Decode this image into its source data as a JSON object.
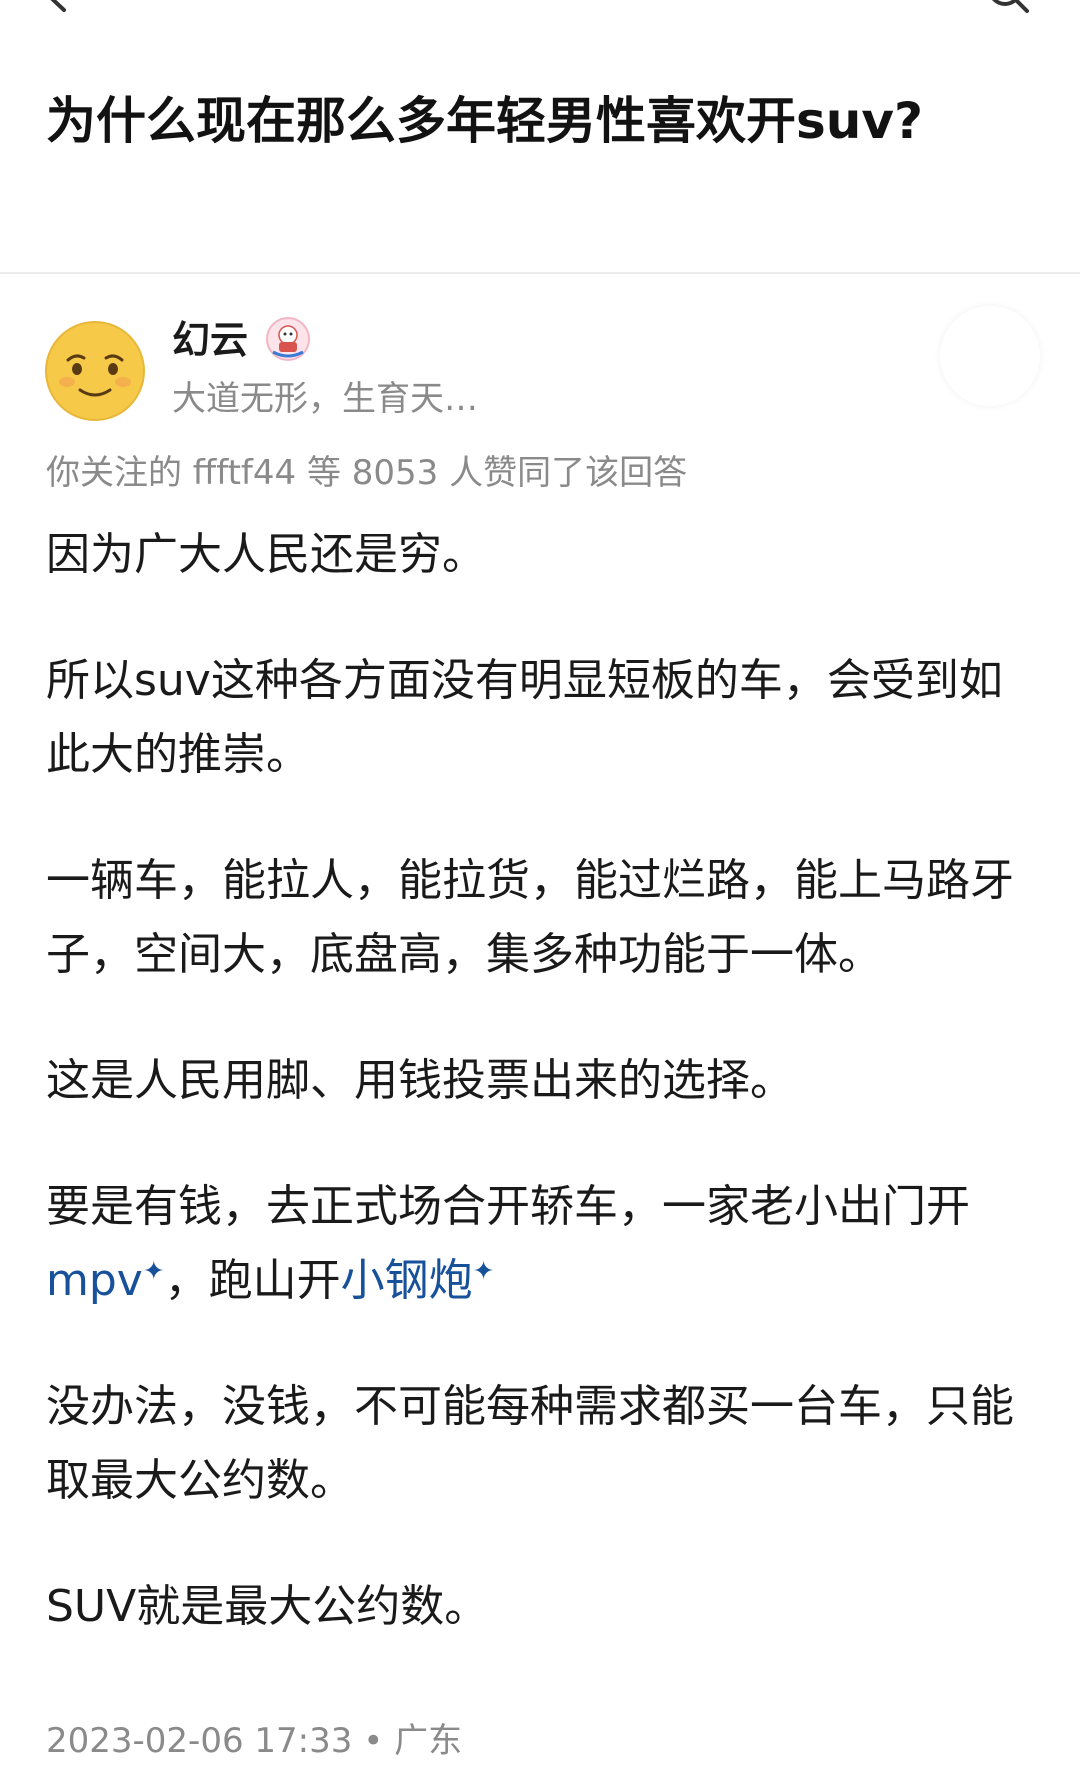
{
  "question": {
    "title": "为什么现在那么多年轻男性喜欢开suv?"
  },
  "author": {
    "name": "幻云",
    "bio": "大道无形，生育天…"
  },
  "upvotes": {
    "text": "你关注的 ffftf44 等 8053 人赞同了该回答"
  },
  "answer": {
    "p1": "因为广大人民还是穷。",
    "p2": "所以suv这种各方面没有明显短板的车，会受到如此大的推崇。",
    "p3": "一辆车，能拉人，能拉货，能过烂路，能上马路牙子，空间大，底盘高，集多种功能于一体。",
    "p4": "这是人民用脚、用钱投票出来的选择。",
    "p5_start": "要是有钱，去正式场合开轿车，一家老小出门开",
    "p5_link1": "mpv",
    "p5_mid": "，跑山开",
    "p5_link2": "小钢炮",
    "p6": "没办法，没钱，不可能每种需求都买一台车，只能取最大公约数。",
    "p7": "SUV就是最大公约数。"
  },
  "meta": {
    "date": "2023-02-06 17:33",
    "separator": "•",
    "location": "广东"
  },
  "icons": {
    "star": "✦"
  },
  "colors": {
    "link": "#175199",
    "muted": "#8a8a8a",
    "text": "#1a1a1a",
    "avatar_yellow": "#f7c948"
  }
}
